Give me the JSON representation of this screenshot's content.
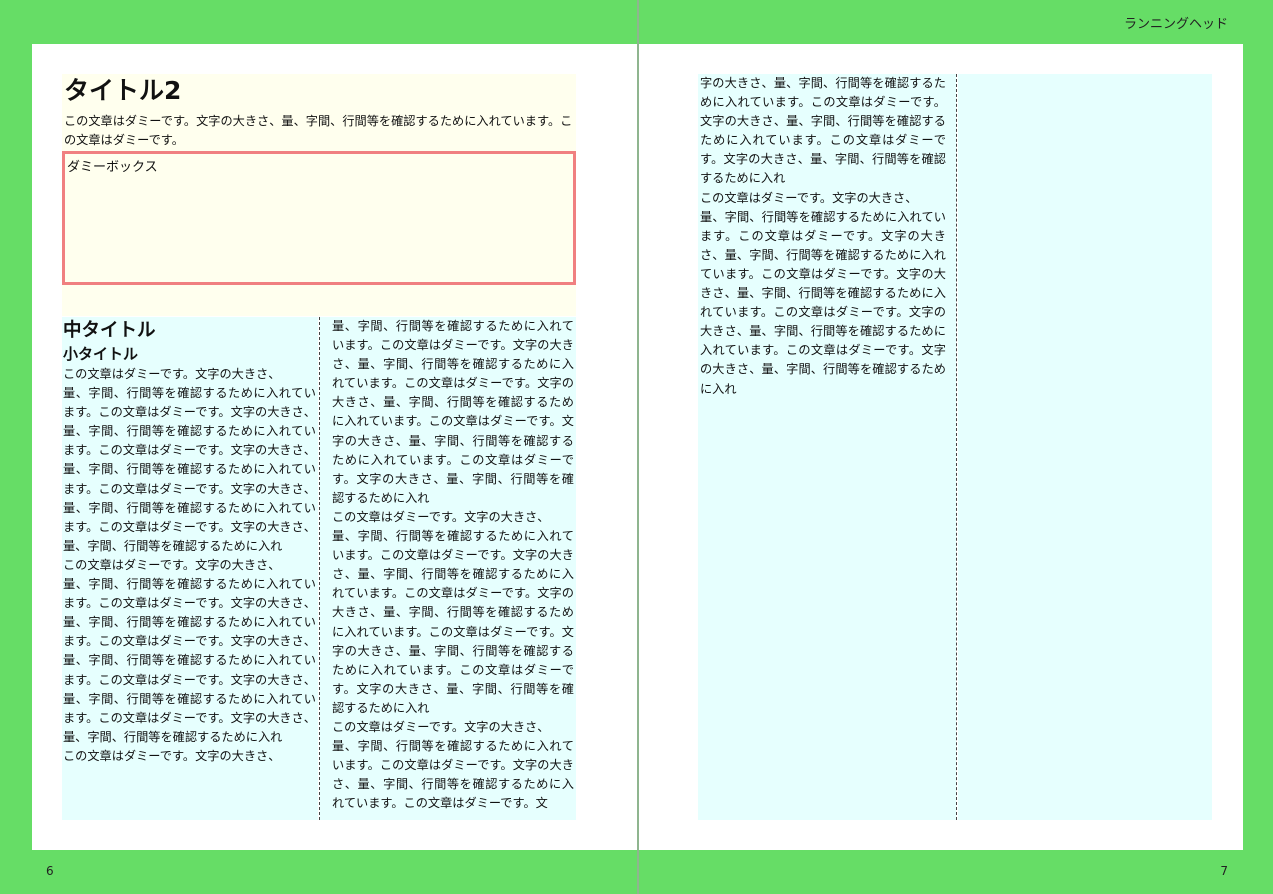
{
  "running_head": "ランニングヘッド",
  "left_page": {
    "page_number": "6",
    "title": "タイトル2",
    "intro": "この文章はダミーです。文字の大きさ、量、字間、行間等を確認するために入れています。この文章はダミーです。",
    "dummy_box_label": "ダミーボックス",
    "mid_title": "中タイトル",
    "small_title": "小タイトル",
    "column1_text": "この文章はダミーです。文字の大きさ、\n量、字間、行間等を確認するために入れています。この文章はダミーです。文字の大きさ、量、字間、行間等を確認するために入れています。この文章はダミーです。文字の大きさ、量、字間、行間等を確認するために入れています。この文章はダミーです。文字の大きさ、量、字間、行間等を確認するために入れています。この文章はダミーです。文字の大きさ、量、字間、行間等を確認するために入れ\nこの文章はダミーです。文字の大きさ、\n量、字間、行間等を確認するために入れています。この文章はダミーです。文字の大きさ、量、字間、行間等を確認するために入れています。この文章はダミーです。文字の大きさ、量、字間、行間等を確認するために入れています。この文章はダミーです。文字の大きさ、量、字間、行間等を確認するために入れています。この文章はダミーです。文字の大きさ、量、字間、行間等を確認するために入れ\nこの文章はダミーです。文字の大きさ、",
    "column2_text": "量、字間、行間等を確認するために入れています。この文章はダミーです。文字の大きさ、量、字間、行間等を確認するために入れています。この文章はダミーです。文字の大きさ、量、字間、行間等を確認するために入れています。この文章はダミーです。文字の大きさ、量、字間、行間等を確認するために入れています。この文章はダミーです。文字の大きさ、量、字間、行間等を確認するために入れ\nこの文章はダミーです。文字の大きさ、\n量、字間、行間等を確認するために入れています。この文章はダミーです。文字の大きさ、量、字間、行間等を確認するために入れています。この文章はダミーです。文字の大きさ、量、字間、行間等を確認するために入れています。この文章はダミーです。文字の大きさ、量、字間、行間等を確認するために入れています。この文章はダミーです。文字の大きさ、量、字間、行間等を確認するために入れ\nこの文章はダミーです。文字の大きさ、\n量、字間、行間等を確認するために入れています。この文章はダミーです。文字の大きさ、量、字間、行間等を確認するために入れています。この文章はダミーです。文"
  },
  "right_page": {
    "page_number": "7",
    "column1_text": "字の大きさ、量、字間、行間等を確認するために入れています。この文章はダミーです。文字の大きさ、量、字間、行間等を確認するために入れています。この文章はダミーです。文字の大きさ、量、字間、行間等を確認するために入れ\nこの文章はダミーです。文字の大きさ、\n量、字間、行間等を確認するために入れています。この文章はダミーです。文字の大きさ、量、字間、行間等を確認するために入れています。この文章はダミーです。文字の大きさ、量、字間、行間等を確認するために入れています。この文章はダミーです。文字の大きさ、量、字間、行間等を確認するために入れています。この文章はダミーです。文字の大きさ、量、字間、行間等を確認するために入れ",
    "column2_text": ""
  }
}
